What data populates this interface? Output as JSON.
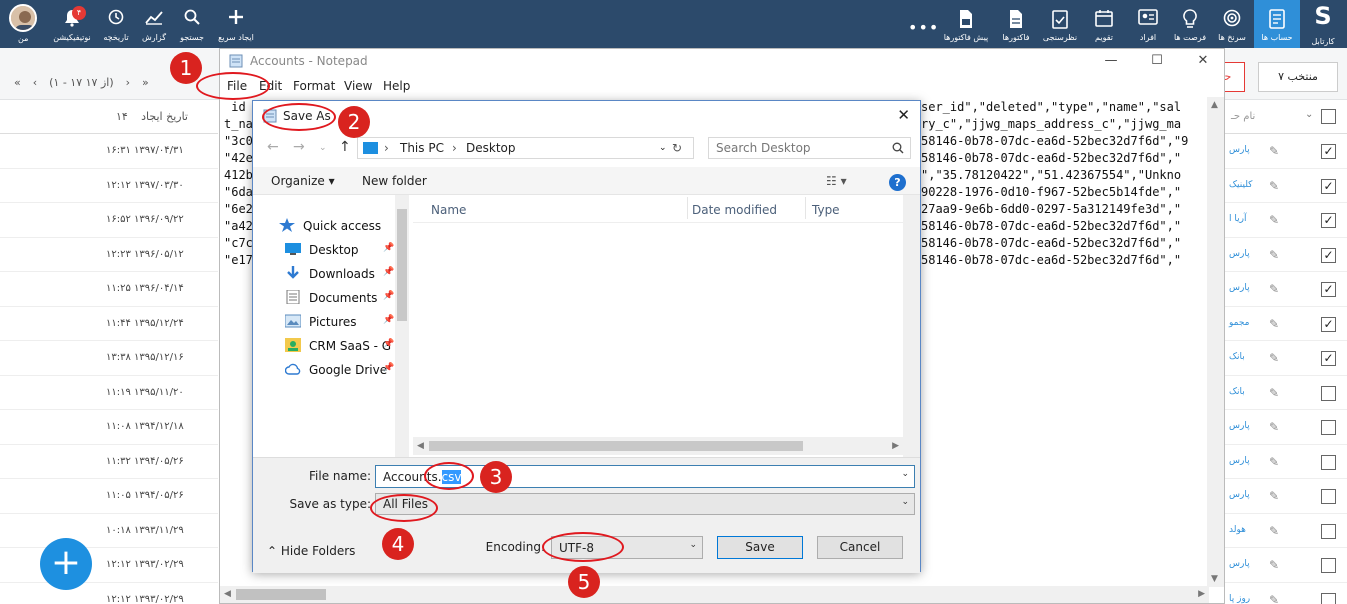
{
  "topbar": {
    "logo": "S",
    "logo_label": "کارتابل",
    "right_items": [
      {
        "label": "حساب ها",
        "icon": "phone-book-icon"
      },
      {
        "label": "سرنخ ها",
        "icon": "target-icon"
      },
      {
        "label": "فرصت ها",
        "icon": "lightbulb-icon"
      },
      {
        "label": "افراد",
        "icon": "contact-card-icon"
      },
      {
        "label": "تقویم",
        "icon": "calendar-icon"
      },
      {
        "label": "نظرسنجی",
        "icon": "survey-icon"
      },
      {
        "label": "فاکتورها",
        "icon": "invoice-icon"
      },
      {
        "label": "پیش فاکتورها",
        "icon": "pre-invoice-icon"
      }
    ],
    "more": "•••",
    "left_items": [
      {
        "label": "ایجاد سریع",
        "icon": "plus-icon"
      },
      {
        "label": "جستجو",
        "icon": "search-icon"
      },
      {
        "label": "گزارش",
        "icon": "report-chart-icon"
      },
      {
        "label": "تاریخچه",
        "icon": "history-icon"
      },
      {
        "label": "نوتیفیکیشن",
        "icon": "bell-icon"
      },
      {
        "label": "من",
        "icon": "avatar"
      }
    ],
    "notification_count": "۴"
  },
  "subbar": {
    "pager": "(۱ - ۱۷ از ۱۷)",
    "selected_label": "منتخب",
    "selected_count": "۷",
    "delete_label": "حذ"
  },
  "left_column": {
    "header": "تاریخ ایجاد",
    "header_num": "۱۴",
    "dates": [
      "۱۶:۳۱ ۱۳۹۷/۰۴/۳۱",
      "۱۲:۱۲ ۱۳۹۷/۰۳/۳۰",
      "۱۶:۵۲ ۱۳۹۶/۰۹/۲۲",
      "۱۲:۲۳ ۱۳۹۶/۰۵/۱۲",
      "۱۱:۲۵ ۱۳۹۶/۰۴/۱۴",
      "۱۱:۴۴ ۱۳۹۵/۱۲/۲۴",
      "۱۳:۳۸ ۱۳۹۵/۱۲/۱۶",
      "۱۱:۱۹ ۱۳۹۵/۱۱/۲۰",
      "۱۱:۰۸ ۱۳۹۴/۱۲/۱۸",
      "۱۱:۳۲ ۱۳۹۴/۰۵/۲۶",
      "۱۱:۰۵ ۱۳۹۴/۰۵/۲۶",
      "۱۰:۱۸ ۱۳۹۳/۱۱/۲۹",
      "۱۲:۱۲ ۱۳۹۳/۰۲/۲۹",
      "۱۲:۱۲ ۱۳۹۳/۰۲/۲۹"
    ]
  },
  "right_column": {
    "header": "نام حـ",
    "rows": [
      {
        "name": "پارس",
        "checked": true
      },
      {
        "name": "کلینیک",
        "checked": true
      },
      {
        "name": "آریا ا",
        "checked": true
      },
      {
        "name": "پارس",
        "checked": true
      },
      {
        "name": "پارس",
        "checked": true
      },
      {
        "name": "مجمو",
        "checked": true
      },
      {
        "name": "بانک",
        "checked": true
      },
      {
        "name": "بانک",
        "checked": false
      },
      {
        "name": "پارس",
        "checked": false
      },
      {
        "name": "پارس",
        "checked": false
      },
      {
        "name": "پارس",
        "checked": false
      },
      {
        "name": "هولد",
        "checked": false
      },
      {
        "name": "پارس",
        "checked": false
      },
      {
        "name": "روز پا",
        "checked": false
      }
    ]
  },
  "notepad": {
    "title": "Accounts - Notepad",
    "menu": [
      "File",
      "Edit",
      "Format",
      "View",
      "Help"
    ],
    "lines_left": [
      " id",
      "t_na",
      "\"3c0",
      "\"42e",
      "412b",
      "\"6da",
      "\"6e2",
      "\"a42",
      "\"c7c",
      "\"e17"
    ],
    "lines_right": [
      "ser_id\",\"deleted\",\"type\",\"name\",\"sal",
      "ry_c\",\"jjwg_maps_address_c\",\"jjwg_ma",
      "58146-0b78-07dc-ea6d-52bec32d7f6d\",\"9",
      "58146-0b78-07dc-ea6d-52bec32d7f6d\",\"",
      "\",\"35.78120422\",\"51.42367554\",\"Unkno",
      "90228-1976-0d10-f967-52bec5b14fde\",\"",
      "27aa9-9e6b-6dd0-0297-5a312149fe3d\",\"",
      "58146-0b78-07dc-ea6d-52bec32d7f6d\",\"",
      "58146-0b78-07dc-ea6d-52bec32d7f6d\",\"",
      "58146-0b78-07dc-ea6d-52bec32d7f6d\",\""
    ]
  },
  "dialog": {
    "title": "Save As",
    "breadcrumb": [
      "This PC",
      "Desktop"
    ],
    "search_placeholder": "Search Desktop",
    "organize": "Organize ▾",
    "new_folder": "New folder",
    "nav": [
      {
        "label": "Quick access",
        "icon": "star-icon"
      },
      {
        "label": "Desktop",
        "icon": "desktop-icon"
      },
      {
        "label": "Downloads",
        "icon": "download-arrow-icon"
      },
      {
        "label": "Documents",
        "icon": "document-icon"
      },
      {
        "label": "Pictures",
        "icon": "pictures-icon"
      },
      {
        "label": "CRM SaaS - G",
        "icon": "crm-shortcut-icon"
      },
      {
        "label": "Google Drive",
        "icon": "cloud-icon"
      }
    ],
    "columns": [
      "Name",
      "Date modified",
      "Type"
    ],
    "file_name_label": "File name:",
    "file_name_prefix": "Accounts.",
    "file_name_ext": "csv",
    "save_type_label": "Save as type:",
    "save_type_value": "All Files",
    "encoding_label": "Encoding:",
    "encoding_value": "UTF-8",
    "save_button": "Save",
    "cancel_button": "Cancel",
    "hide_folders": "Hide Folders"
  },
  "annotations": [
    "1",
    "2",
    "3",
    "4",
    "5"
  ],
  "colors": {
    "navbar": "#2c4a6b",
    "accent": "#2f8fd8",
    "annotation": "#d9231f"
  }
}
